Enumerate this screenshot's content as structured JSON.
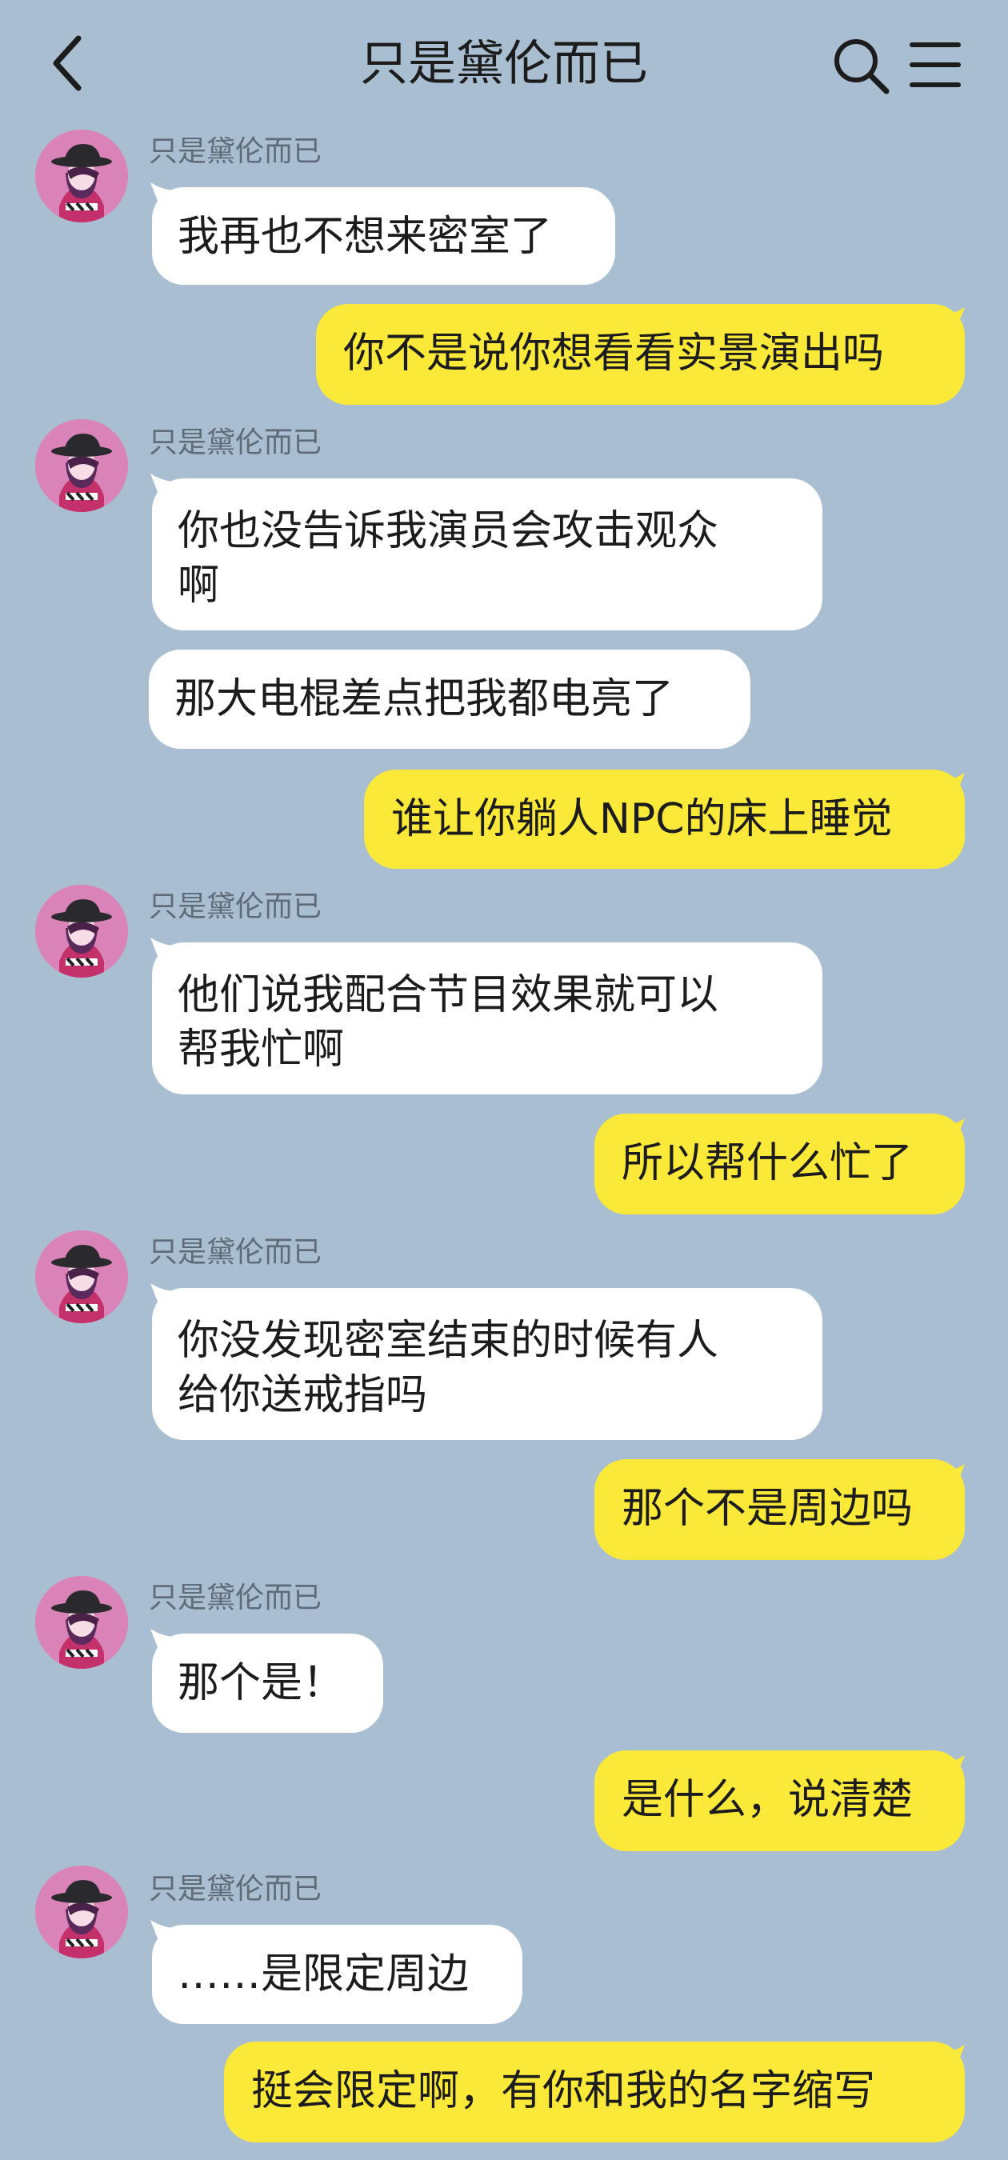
{
  "header": {
    "title": "只是黛伦而已",
    "back_icon": "chevron-left-icon",
    "search_icon": "search-icon",
    "menu_icon": "hamburger-menu-icon"
  },
  "colors": {
    "background": "#a9bed1",
    "incoming_bubble": "#ffffff",
    "outgoing_bubble": "#fbe939"
  },
  "messages": [
    {
      "sender": "只是黛伦而已",
      "text": "我再也不想来密室了"
    },
    {
      "text": "你不是说你想看看实景演出吗"
    },
    {
      "sender": "只是黛伦而已",
      "text": "你也没告诉我演员会攻击观众\n啊"
    },
    {
      "text": "那大电棍差点把我都电亮了"
    },
    {
      "text": "谁让你躺人NPC的床上睡觉"
    },
    {
      "sender": "只是黛伦而已",
      "text": "他们说我配合节目效果就可以\n帮我忙啊"
    },
    {
      "text": "所以帮什么忙了"
    },
    {
      "sender": "只是黛伦而已",
      "text": "你没发现密室结束的时候有人\n给你送戒指吗"
    },
    {
      "text": "那个不是周边吗"
    },
    {
      "sender": "只是黛伦而已",
      "text": "那个是！"
    },
    {
      "text": "是什么，说清楚"
    },
    {
      "sender": "只是黛伦而已",
      "text": "……是限定周边"
    },
    {
      "text": "挺会限定啊，有你和我的名字缩写"
    }
  ]
}
